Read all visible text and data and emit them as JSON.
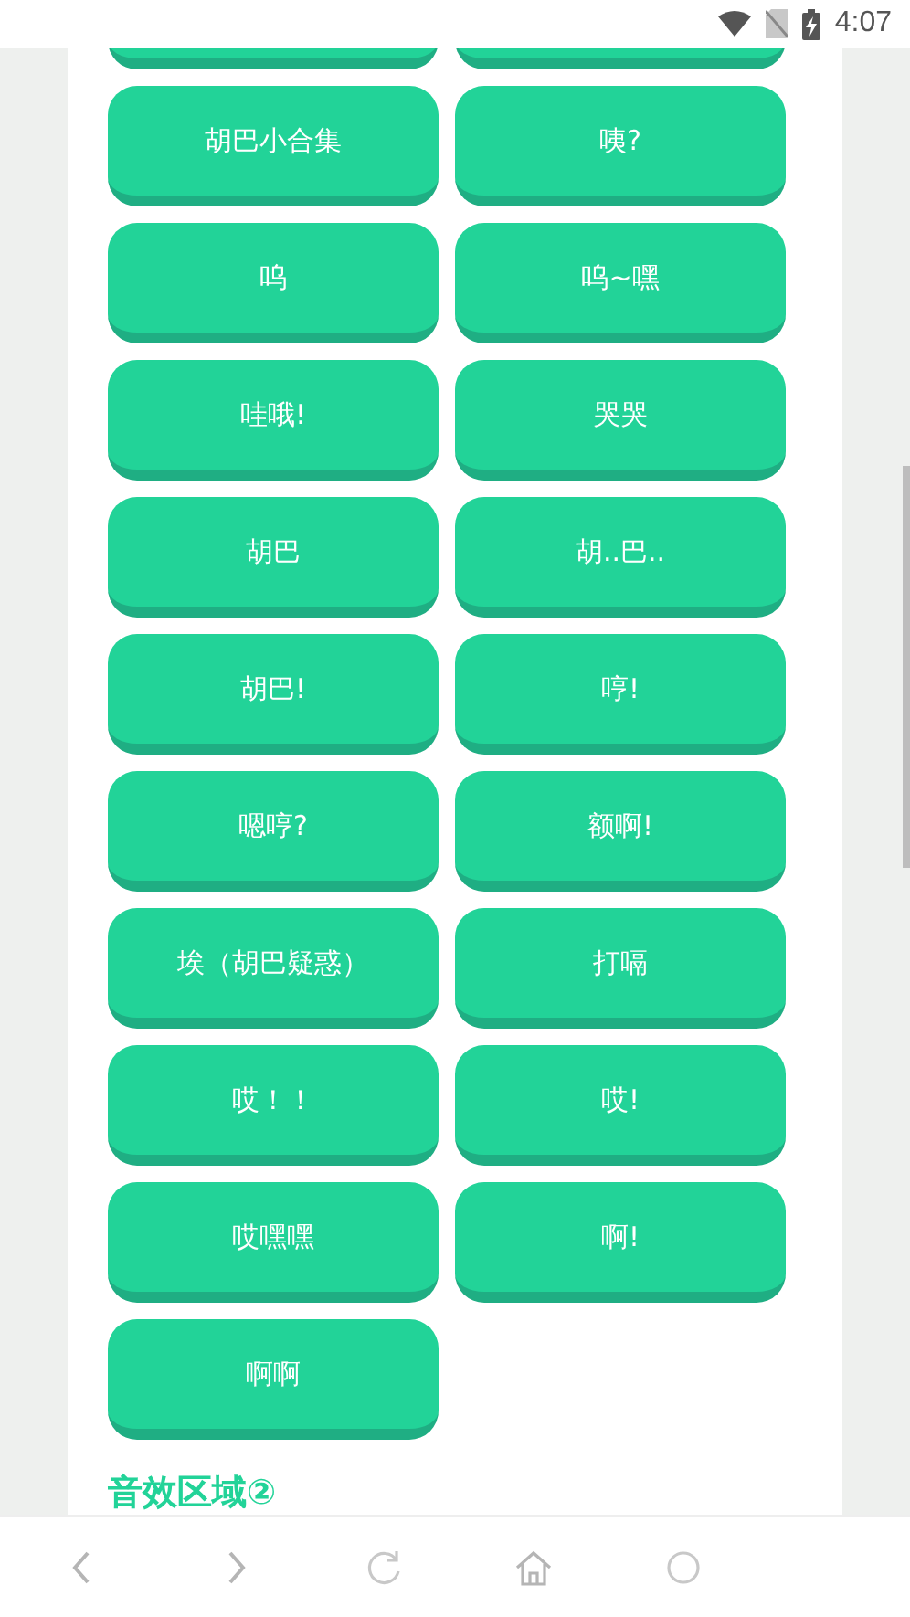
{
  "status_bar": {
    "time": "4:07"
  },
  "buttons": [
    {
      "kind": "cut"
    },
    {
      "kind": "cut"
    },
    {
      "kind": "sound",
      "label": "胡巴小合集"
    },
    {
      "kind": "sound",
      "label": "咦?"
    },
    {
      "kind": "sound",
      "label": "呜"
    },
    {
      "kind": "sound",
      "label": "呜~嘿"
    },
    {
      "kind": "sound",
      "label": "哇哦!"
    },
    {
      "kind": "sound",
      "label": "哭哭"
    },
    {
      "kind": "sound",
      "label": "胡巴"
    },
    {
      "kind": "sound",
      "label": "胡..巴.."
    },
    {
      "kind": "sound",
      "label": "胡巴!"
    },
    {
      "kind": "sound",
      "label": "哼!"
    },
    {
      "kind": "sound",
      "label": "嗯哼?"
    },
    {
      "kind": "sound",
      "label": "额啊!"
    },
    {
      "kind": "sound",
      "label": "埃（胡巴疑惑）"
    },
    {
      "kind": "sound",
      "label": "打嗝"
    },
    {
      "kind": "sound",
      "label": "哎！！"
    },
    {
      "kind": "sound",
      "label": "哎!"
    },
    {
      "kind": "sound",
      "label": "哎嘿嘿"
    },
    {
      "kind": "sound",
      "label": "啊!"
    },
    {
      "kind": "sound",
      "label": "啊啊"
    }
  ],
  "section_heading": "音效区域②",
  "nav_bar": [
    {
      "kind": "back"
    },
    {
      "kind": "forward"
    },
    {
      "kind": "refresh"
    },
    {
      "kind": "home"
    },
    {
      "kind": "circle"
    }
  ]
}
